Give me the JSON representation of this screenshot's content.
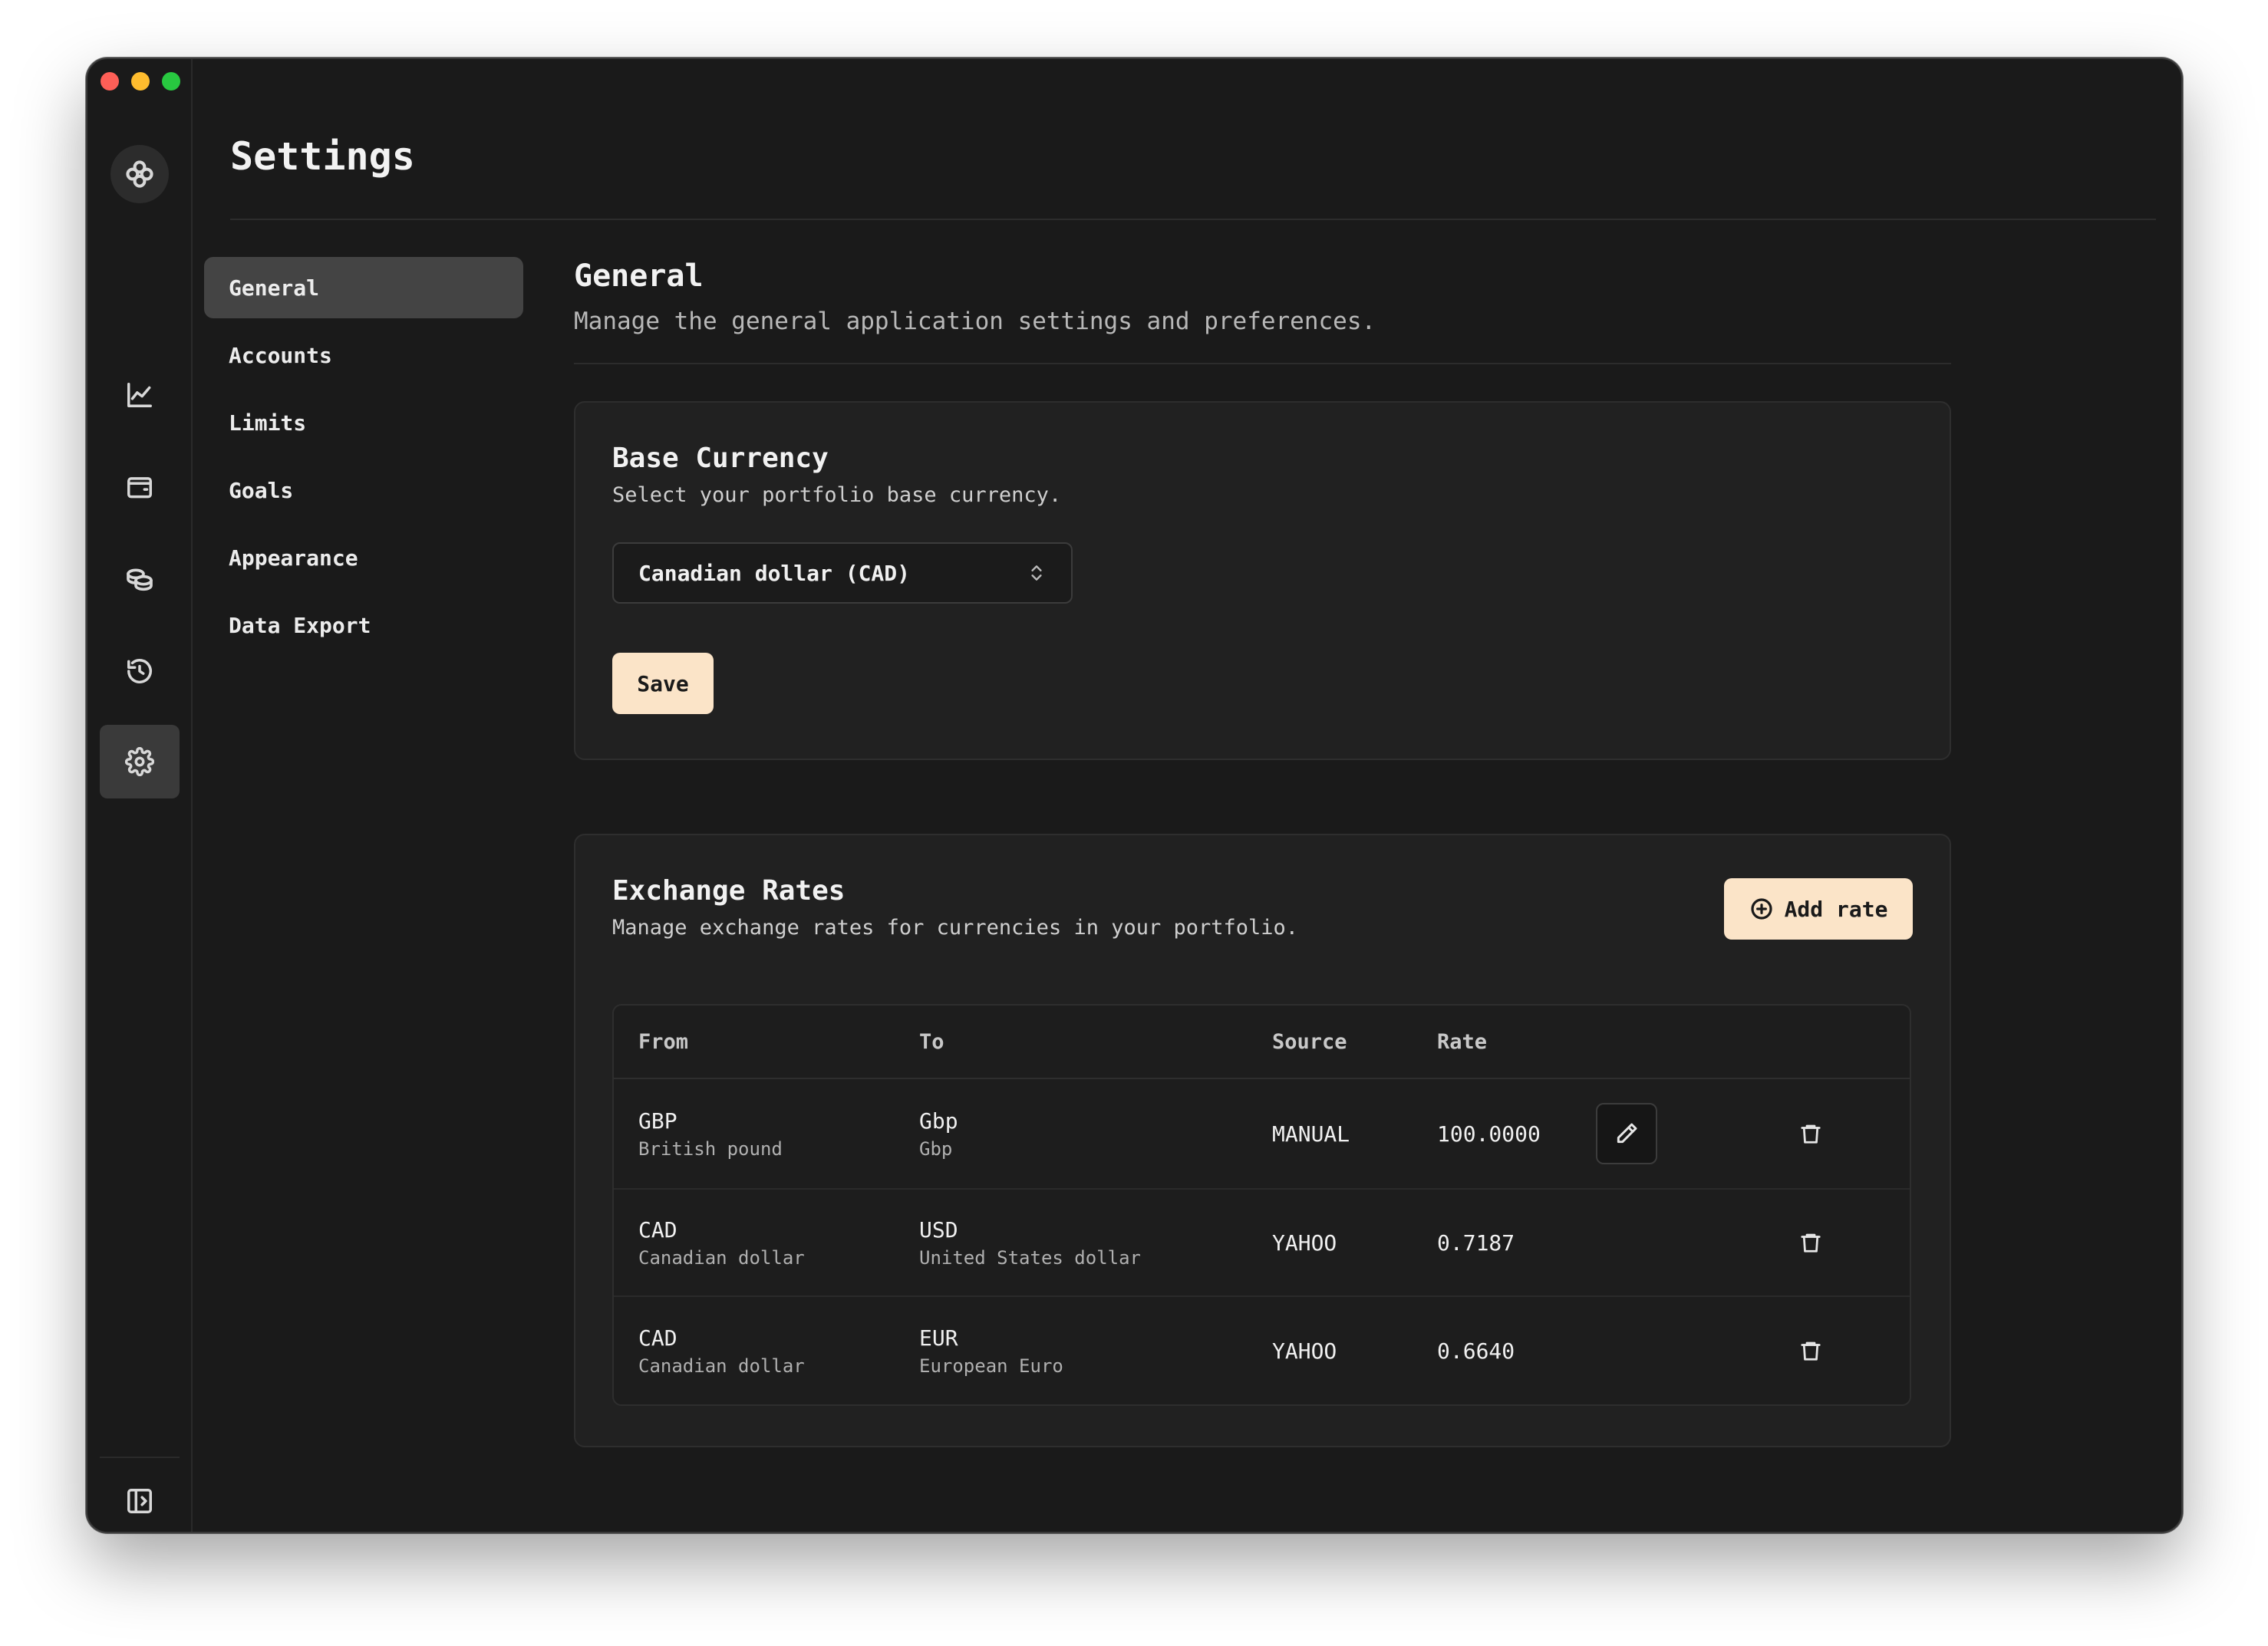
{
  "window": {
    "title": "Settings",
    "traffic_lights": [
      "close",
      "minimize",
      "zoom"
    ]
  },
  "rail": {
    "logo_icon": "app-logo-icon",
    "items": [
      {
        "icon": "chart-line-icon",
        "active": false
      },
      {
        "icon": "wallet-icon",
        "active": false
      },
      {
        "icon": "coins-icon",
        "active": false
      },
      {
        "icon": "history-icon",
        "active": false
      },
      {
        "icon": "gear-icon",
        "active": true
      }
    ],
    "footer_icon": "panel-toggle-icon"
  },
  "subnav": {
    "items": [
      {
        "label": "General",
        "active": true
      },
      {
        "label": "Accounts",
        "active": false
      },
      {
        "label": "Limits",
        "active": false
      },
      {
        "label": "Goals",
        "active": false
      },
      {
        "label": "Appearance",
        "active": false
      },
      {
        "label": "Data Export",
        "active": false
      }
    ]
  },
  "general": {
    "title": "General",
    "description": "Manage the general application settings and preferences."
  },
  "base_currency": {
    "title": "Base Currency",
    "description": "Select your portfolio base currency.",
    "selected": "Canadian dollar (CAD)",
    "save_label": "Save"
  },
  "exchange_rates": {
    "title": "Exchange Rates",
    "description": "Manage exchange rates for currencies in your portfolio.",
    "add_label": "Add rate",
    "columns": [
      "From",
      "To",
      "Source",
      "Rate"
    ],
    "rows": [
      {
        "from_code": "GBP",
        "from_name": "British pound",
        "to_code": "Gbp",
        "to_name": "Gbp",
        "source": "MANUAL",
        "rate": "100.0000",
        "editable": true
      },
      {
        "from_code": "CAD",
        "from_name": "Canadian dollar",
        "to_code": "USD",
        "to_name": "United States dollar",
        "source": "YAHOO",
        "rate": "0.7187",
        "editable": false
      },
      {
        "from_code": "CAD",
        "from_name": "Canadian dollar",
        "to_code": "EUR",
        "to_name": "European Euro",
        "source": "YAHOO",
        "rate": "0.6640",
        "editable": false
      }
    ]
  },
  "colors": {
    "window_bg": "#1a1a1a",
    "card_bg": "#212121",
    "accent_button": "#fbe4c8",
    "active_nav": "#444444"
  }
}
